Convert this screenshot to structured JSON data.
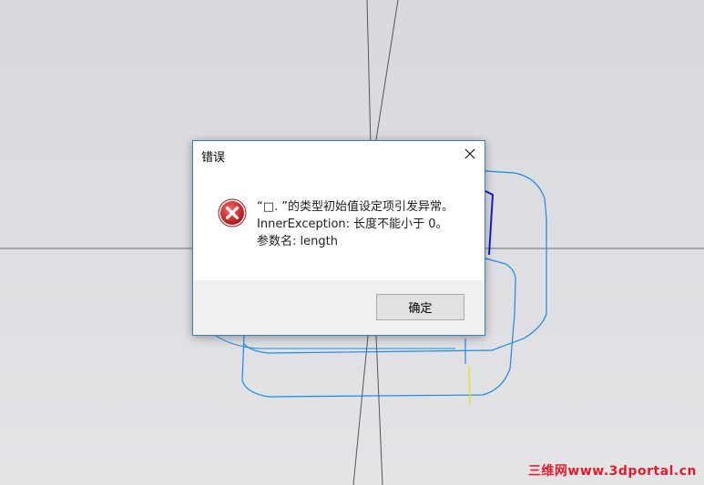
{
  "dialog": {
    "title": "错误",
    "close_glyph": "✕",
    "icon": "error-icon",
    "message": {
      "line1": "“□. ”的类型初始值设定项引发异常。",
      "line2": "InnerException: 长度不能小于 0。",
      "line3": "参数名: length"
    },
    "ok_label": "确定"
  },
  "watermark": "三维网www.3dportal.cn",
  "colors": {
    "background": "#dcdee1",
    "sketch_blue": "#1e88e5",
    "axis_gray": "#555555",
    "dialog_border": "#3c7fb1",
    "error_red": "#c8262e",
    "watermark_red": "#e8182a"
  }
}
